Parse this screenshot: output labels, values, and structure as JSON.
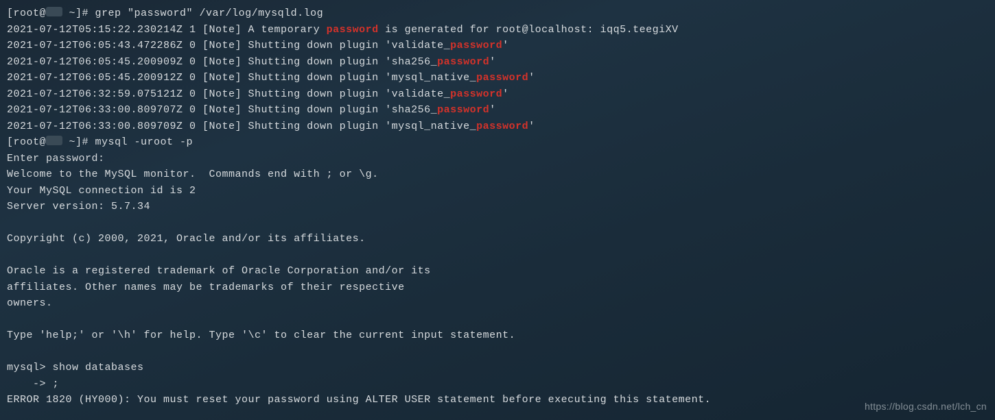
{
  "prompt1_pre": "[root@",
  "prompt1_post": " ~]# ",
  "cmd1": "grep \"password\" /var/log/mysqld.log",
  "grep": [
    {
      "pre": "2021-07-12T05:15:22.230214Z 1 [Note] A temporary ",
      "hl": "password",
      "post": " is generated for root@localhost: iqq5.teegiXV"
    },
    {
      "pre": "2021-07-12T06:05:43.472286Z 0 [Note] Shutting down plugin 'validate_",
      "hl": "password",
      "post": "'"
    },
    {
      "pre": "2021-07-12T06:05:45.200909Z 0 [Note] Shutting down plugin 'sha256_",
      "hl": "password",
      "post": "'"
    },
    {
      "pre": "2021-07-12T06:05:45.200912Z 0 [Note] Shutting down plugin 'mysql_native_",
      "hl": "password",
      "post": "'"
    },
    {
      "pre": "2021-07-12T06:32:59.075121Z 0 [Note] Shutting down plugin 'validate_",
      "hl": "password",
      "post": "'"
    },
    {
      "pre": "2021-07-12T06:33:00.809707Z 0 [Note] Shutting down plugin 'sha256_",
      "hl": "password",
      "post": "'"
    },
    {
      "pre": "2021-07-12T06:33:00.809709Z 0 [Note] Shutting down plugin 'mysql_native_",
      "hl": "password",
      "post": "'"
    }
  ],
  "cmd2": "mysql -uroot -p",
  "mysql_block": "Enter password: \nWelcome to the MySQL monitor.  Commands end with ; or \\g.\nYour MySQL connection id is 2\nServer version: 5.7.34\n\nCopyright (c) 2000, 2021, Oracle and/or its affiliates.\n\nOracle is a registered trademark of Oracle Corporation and/or its\naffiliates. Other names may be trademarks of their respective\nowners.\n\nType 'help;' or '\\h' for help. Type '\\c' to clear the current input statement.\n\nmysql> show databases\n    -> ;\nERROR 1820 (HY000): You must reset your password using ALTER USER statement before executing this statement.",
  "watermark": "https://blog.csdn.net/lch_cn"
}
